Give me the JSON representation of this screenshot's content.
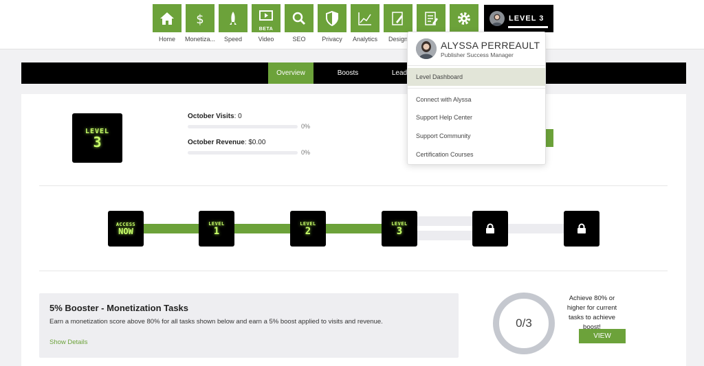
{
  "top_nav": {
    "items": [
      {
        "label": "Home",
        "icon": "home-icon"
      },
      {
        "label": "Monetiza...",
        "icon": "dollar-icon"
      },
      {
        "label": "Speed",
        "icon": "rocket-icon"
      },
      {
        "label": "Video",
        "icon": "video-icon",
        "badge": "BETA"
      },
      {
        "label": "SEO",
        "icon": "magnifier-icon"
      },
      {
        "label": "Privacy",
        "icon": "shield-icon"
      },
      {
        "label": "Analytics",
        "icon": "chart-line-icon"
      },
      {
        "label": "Design",
        "icon": "design-pencil-icon"
      },
      {
        "label": "",
        "icon": "document-edit-icon"
      },
      {
        "label": "",
        "icon": "gear-icon"
      }
    ],
    "level_button": "LEVEL 3"
  },
  "sub_nav": {
    "tabs": [
      {
        "label": "Overview",
        "active": true
      },
      {
        "label": "Boosts",
        "active": false
      },
      {
        "label": "Lead",
        "active": false
      }
    ]
  },
  "summary": {
    "badge_top": "LEVEL",
    "badge_num": "3",
    "visits_label": "October Visits",
    "visits_value": ": 0",
    "visits_pct": "0%",
    "visits_progress": 0,
    "revenue_label": "October Revenue",
    "revenue_value": ": $0.00",
    "revenue_pct": "0%",
    "revenue_progress": 0
  },
  "levels": {
    "steps": [
      {
        "top": "ACCESS",
        "bottom": "NOW",
        "locked": false
      },
      {
        "top": "LEVEL",
        "bottom": "1",
        "locked": false
      },
      {
        "top": "LEVEL",
        "bottom": "2",
        "locked": false
      },
      {
        "top": "LEVEL",
        "bottom": "3",
        "locked": false
      },
      {
        "top": "",
        "bottom": "",
        "locked": true
      },
      {
        "top": "",
        "bottom": "",
        "locked": true
      }
    ]
  },
  "booster": {
    "title": "5% Booster - Monetization Tasks",
    "description": "Earn a monetization score above 80% for all tasks shown below and earn a 5% boost applied to visits and revenue.",
    "link": "Show Details",
    "score": "0/3",
    "note": "Achieve 80% or higher for current tasks to achieve boost!",
    "button": "VIEW DETAILS"
  },
  "dropdown": {
    "name": "ALYSSA PERREAULT",
    "role": "Publisher Success Manager",
    "items": [
      {
        "label": "Level Dashboard",
        "active": true
      },
      {
        "label": "Connect with Alyssa",
        "active": false
      },
      {
        "label": "Support Help Center",
        "active": false
      },
      {
        "label": "Support Community",
        "active": false
      },
      {
        "label": "Certification Courses",
        "active": false
      }
    ]
  },
  "colors": {
    "accent": "#6ca23a",
    "dark": "#000000",
    "glow": "#c9ff6a",
    "track_gray": "#ececf0"
  }
}
